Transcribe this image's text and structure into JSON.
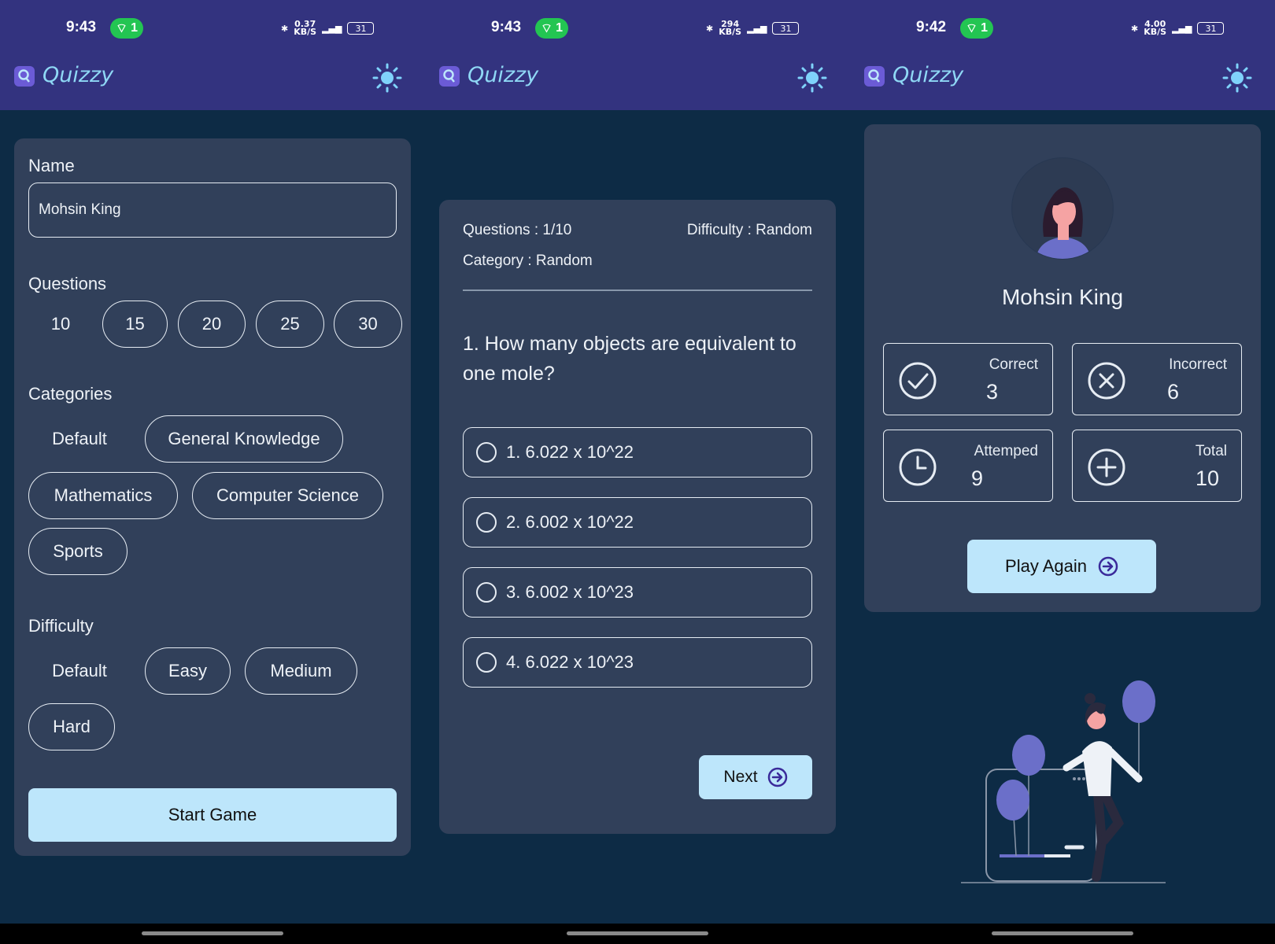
{
  "status_bars": [
    {
      "time": "9:43",
      "hotspot": "1",
      "speed_top": "0.37",
      "speed_bottom": "KB/S",
      "battery": "31"
    },
    {
      "time": "9:43",
      "hotspot": "1",
      "speed_top": "294",
      "speed_bottom": "KB/S",
      "battery": "31"
    },
    {
      "time": "9:42",
      "hotspot": "1",
      "speed_top": "4.00",
      "speed_bottom": "KB/S",
      "battery": "31"
    }
  ],
  "app": {
    "title": "Quizzy",
    "logo_icon": "search-logo-icon",
    "theme_icon": "sun-icon"
  },
  "setup": {
    "name_label": "Name",
    "name_value": "Mohsin King",
    "questions_label": "Questions",
    "question_counts": [
      "10",
      "15",
      "20",
      "25",
      "30"
    ],
    "selected_question_count": "10",
    "categories_label": "Categories",
    "categories": [
      "Default",
      "General Knowledge",
      "Mathematics",
      "Computer Science",
      "Sports"
    ],
    "selected_category": "Default",
    "difficulty_label": "Difficulty",
    "difficulties": [
      "Default",
      "Easy",
      "Medium",
      "Hard"
    ],
    "selected_difficulty": "Default",
    "start_button": "Start Game"
  },
  "quiz": {
    "questions_meta": "Questions : 1/10",
    "difficulty_meta": "Difficulty : Random",
    "category_meta": "Category : Random",
    "question": "1. How many objects are equivalent to one mole?",
    "options": [
      "1. 6.022 x 10^22",
      "2. 6.002 x 10^22",
      "3. 6.002 x 10^23",
      "4. 6.022 x 10^23"
    ],
    "next_button": "Next"
  },
  "result": {
    "name": "Mohsin King",
    "stats": [
      {
        "label": "Correct",
        "value": "3",
        "icon": "check-circle-icon"
      },
      {
        "label": "Incorrect",
        "value": "6",
        "icon": "x-circle-icon"
      },
      {
        "label": "Attemped",
        "value": "9",
        "icon": "clock-icon"
      },
      {
        "label": "Total",
        "value": "10",
        "icon": "plus-circle-icon"
      }
    ],
    "play_again_button": "Play Again"
  },
  "colors": {
    "topbar": "#33337f",
    "background": "#0d2b45",
    "card": "#31405a",
    "accent_button": "#bde6fb",
    "hotspot": "#23c552",
    "title": "#8fd8f5",
    "balloon": "#6b6fc9"
  }
}
